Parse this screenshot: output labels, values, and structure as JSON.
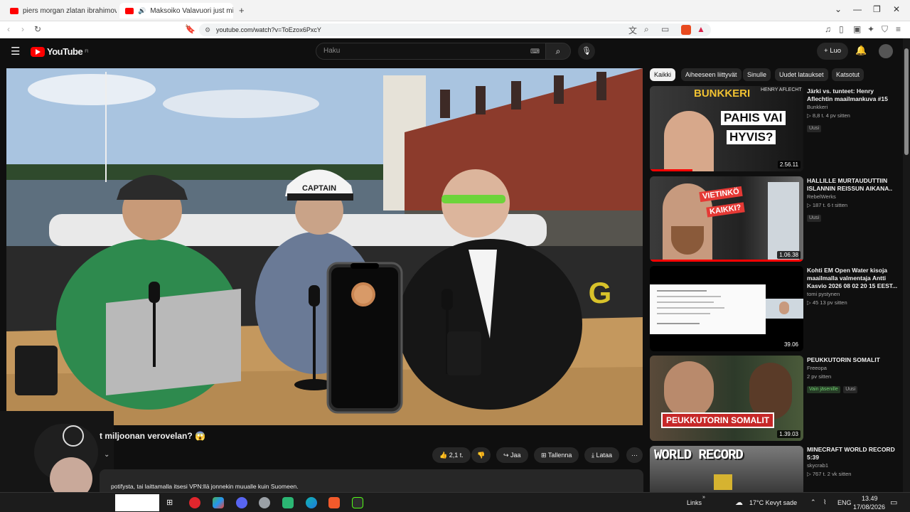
{
  "browser": {
    "tabs": [
      {
        "label": "piers morgan zlatan ibrahimovic - Y"
      },
      {
        "label": "Maksoiko Valavuori just miljo"
      }
    ],
    "new_tab": "+",
    "url": "youtube.com/watch?v=ToEzox6PxcY"
  },
  "youtube": {
    "logo_text": "YouTube",
    "logo_sup": "FI",
    "search_placeholder": "Haku",
    "create_label": "Luo"
  },
  "video": {
    "title": "t miljoonan verovelan? 😱",
    "description": "potifysta, tai laittamalla itsesi VPN:llä jonnekin muualle kuin Suomeen.",
    "actions": {
      "like": "2,1 t.",
      "share": "Jaa",
      "save": "Tallenna",
      "download": "Lataa"
    },
    "player_labels": {
      "cap": "CAPTAIN",
      "logo": "G"
    }
  },
  "chips": [
    "Kaikki",
    "Aiheeseen liittyvät",
    "Sinulle",
    "Uudet lataukset",
    "Katsotut"
  ],
  "recommendations": [
    {
      "title": "Järki vs. tunteet: Henry Aflechtin maailmankuva #15",
      "channel": "Bunkkeri",
      "stats": "▷ 8,8 t.   4 pv sitten",
      "badge": "Uusi",
      "duration": "2.56.11",
      "thumb_text": [
        "BUNKKERI",
        "PAHIS VAI",
        "HYVIS?"
      ],
      "thumb_sub": "HENRY AFLECHT"
    },
    {
      "title": "HALLILLE MURTAUDUTTIIN ISLANNIN REISSUN AIKANA..",
      "channel": "RebelWerks",
      "stats": "▷ 187 t.   6 t sitten",
      "badge": "Uusi",
      "duration": "1.06.38",
      "thumb_text": [
        "VIETINKÖ",
        "KAIKKI?"
      ]
    },
    {
      "title": "Kohti EM Open Water kisoja maailmalla valmentaja Antti Kasvio 2026 08 02 20 15 EEST...",
      "channel": "tomi pystynen",
      "stats": "▷ 45   13 pv sitten",
      "duration": "39.06"
    },
    {
      "title": "PEUKKUTORIN SOMALIT",
      "channel": "Freeopa",
      "stats": "2 pv sitten",
      "badge_green": "Vain jäsenille",
      "badge": "Uusi",
      "duration": "1.39.03",
      "thumb_text": [
        "PEUKKUTORIN SOMALIT"
      ]
    },
    {
      "title": "MINECRAFT WORLD RECORD 5:39",
      "channel": "skycrab1",
      "stats": "▷ 767 t.   2 vk sitten",
      "thumb_text": [
        "WORLD RECORD"
      ]
    }
  ],
  "taskbar": {
    "weather": "17°C  Kevyt sade",
    "links": "Links",
    "lang": "ENG",
    "time": "13.49",
    "date": "17/08/2026"
  }
}
